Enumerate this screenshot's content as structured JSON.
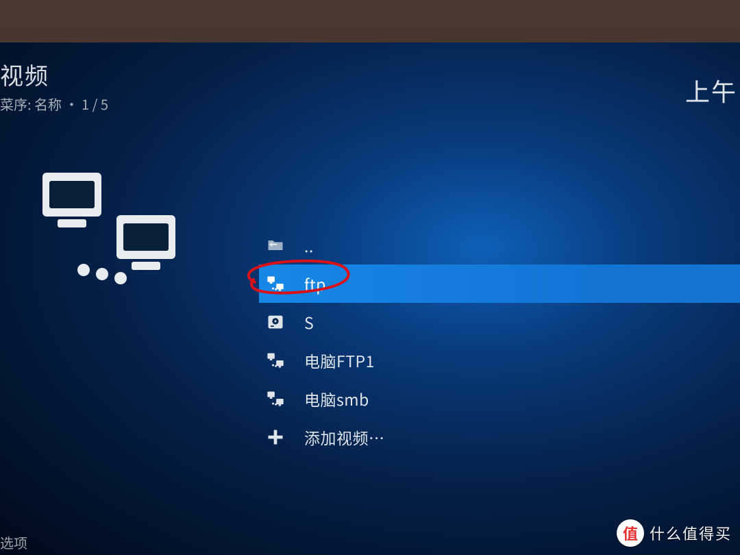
{
  "header": {
    "title": "视频",
    "sort_line": "菜序: 名称  •  1 / 5"
  },
  "clock_label": "上午",
  "list": {
    "items": [
      {
        "icon": "folder-up-icon",
        "label": ".."
      },
      {
        "icon": "network-icon",
        "label": "ftp",
        "selected": true
      },
      {
        "icon": "disk-icon",
        "label": "S"
      },
      {
        "icon": "network-icon",
        "label": "电脑FTP1"
      },
      {
        "icon": "network-icon",
        "label": "电脑smb"
      },
      {
        "icon": "plus-icon",
        "label": "添加视频…"
      }
    ]
  },
  "bottom_left": "选项",
  "watermark": {
    "glyph": "值",
    "text": "什么值得买"
  }
}
